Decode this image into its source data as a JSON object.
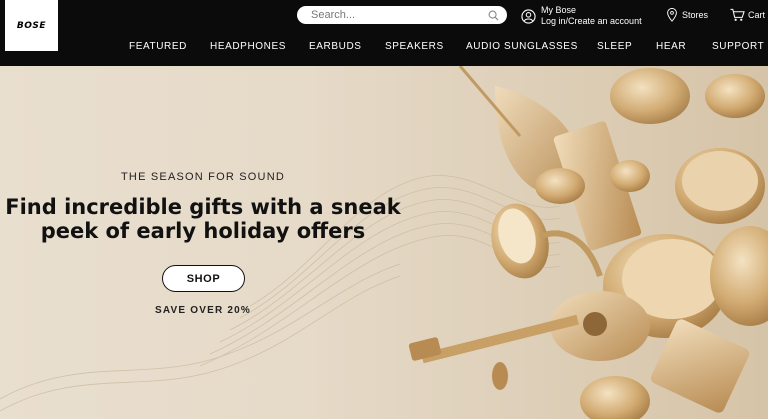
{
  "header": {
    "logo": "BOSE",
    "search": {
      "placeholder": "Search..."
    },
    "account": {
      "title": "My Bose",
      "subtitle": "Log in/Create an account"
    },
    "stores_label": "Stores",
    "cart_label": "Cart"
  },
  "nav": {
    "items": [
      {
        "label": "FEATURED"
      },
      {
        "label": "HEADPHONES"
      },
      {
        "label": "EARBUDS"
      },
      {
        "label": "SPEAKERS"
      },
      {
        "label": "AUDIO SUNGLASSES"
      },
      {
        "label": "SLEEP"
      },
      {
        "label": "HEAR"
      },
      {
        "label": "SUPPORT"
      }
    ]
  },
  "hero": {
    "eyebrow": "THE SEASON FOR SOUND",
    "headline_line1": "Find incredible gifts with a sneak",
    "headline_line2": "peek of early holiday offers",
    "cta_label": "SHOP",
    "note": "SAVE OVER 20%"
  },
  "colors": {
    "header_bg": "#0b0b0b",
    "hero_bg": "#e7dccb",
    "gold": "#c9a46a"
  }
}
